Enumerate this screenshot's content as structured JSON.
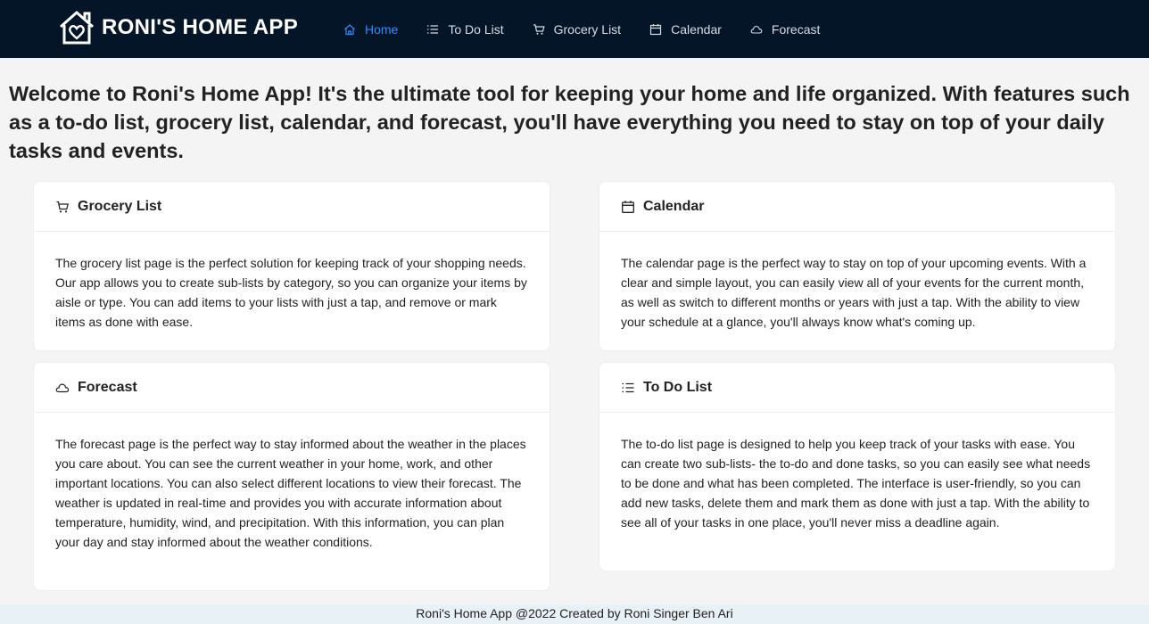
{
  "app": {
    "brand": "RONI'S HOME APP"
  },
  "nav": {
    "items": [
      {
        "label": "Home",
        "icon": "home-icon",
        "active": true
      },
      {
        "label": "To Do List",
        "icon": "list-icon"
      },
      {
        "label": "Grocery List",
        "icon": "cart-icon"
      },
      {
        "label": "Calendar",
        "icon": "calendar-icon"
      },
      {
        "label": "Forecast",
        "icon": "cloud-icon"
      }
    ]
  },
  "welcome": "Welcome to Roni's Home App! It's the ultimate tool for keeping your home and life organized. With features such as a to-do list, grocery list, calendar, and forecast, you'll have everything you need to stay on top of your daily tasks and events.",
  "cards": {
    "grocery": {
      "title": "Grocery List",
      "body": "The grocery list page is the perfect solution for keeping track of your shopping needs. Our app allows you to create sub-lists by category, so you can organize your items by aisle or type. You can add items to your lists with just a tap, and remove or mark items as done with ease."
    },
    "calendar": {
      "title": "Calendar",
      "body": "The calendar page is the perfect way to stay on top of your upcoming events. With a clear and simple layout, you can easily view all of your events for the current month, as well as switch to different months or years with just a tap. With the ability to view your schedule at a glance, you'll always know what's coming up."
    },
    "forecast": {
      "title": "Forecast",
      "body": "The forecast page is the perfect way to stay informed about the weather in the places you care about. You can see the current weather in your home, work, and other important locations. You can also select different locations to view their forecast. The weather is updated in real-time and provides you with accurate information about temperature, humidity, wind, and precipitation. With this information, you can plan your day and stay informed about the weather conditions."
    },
    "todo": {
      "title": "To Do List",
      "body": "The to-do list page is designed to help you keep track of your tasks with ease. You can create two sub-lists- the to-do and done tasks, so you can easily see what needs to be done and what has been completed. The interface is user-friendly, so you can add new tasks, delete them and mark them as done with just a tap. With the ability to see all of your tasks in one place, you'll never miss a deadline again."
    }
  },
  "footer": "Roni's Home App @2022 Created by Roni Singer Ben Ari",
  "colors": {
    "navbar": "#041527",
    "active": "#2f8cff",
    "background": "#f4f4f4"
  }
}
